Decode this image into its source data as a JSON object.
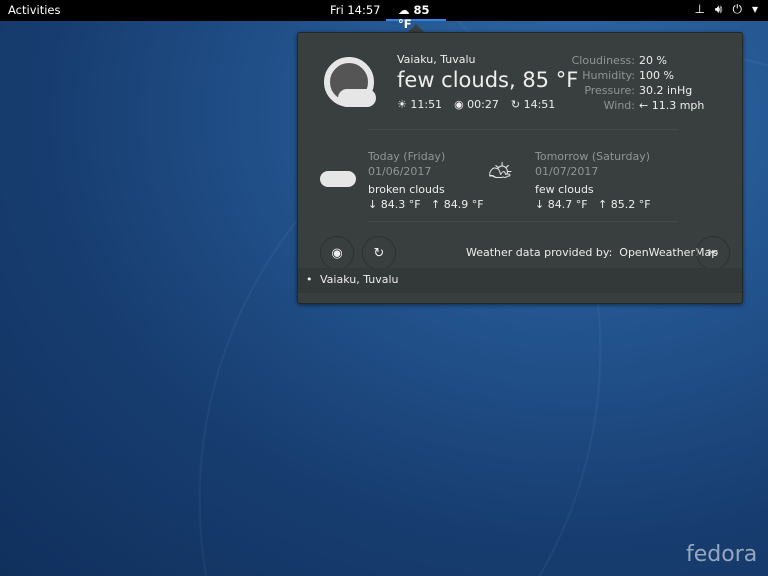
{
  "topbar": {
    "activities": "Activities",
    "clock": "Fri 14:57",
    "weather": "85 °F"
  },
  "current": {
    "location": "Vaiaku, Tuvalu",
    "summary": "few clouds, 85 °F",
    "sunrise": "11:51",
    "sunset": "00:27",
    "updated": "14:51",
    "stats": [
      {
        "k": "Cloudiness:",
        "v": "20 %"
      },
      {
        "k": "Humidity:",
        "v": "100 %"
      },
      {
        "k": "Pressure:",
        "v": "30.2 inHg"
      },
      {
        "k": "Wind:",
        "v": "← 11.3 mph"
      }
    ]
  },
  "forecast": [
    {
      "day": "Today (Friday)",
      "date": "01/06/2017",
      "desc": "broken clouds",
      "low": "↓ 84.3 °F",
      "high": "↑ 84.9 °F"
    },
    {
      "day": "Tomorrow (Saturday)",
      "date": "01/07/2017",
      "desc": "few clouds",
      "low": "↓ 84.7 °F",
      "high": "↑ 85.2 °F"
    }
  ],
  "provider": {
    "label": "Weather data provided by:",
    "name": "OpenWeatherMap"
  },
  "locations": [
    "Vaiaku, Tuvalu"
  ],
  "watermark": "fedora"
}
